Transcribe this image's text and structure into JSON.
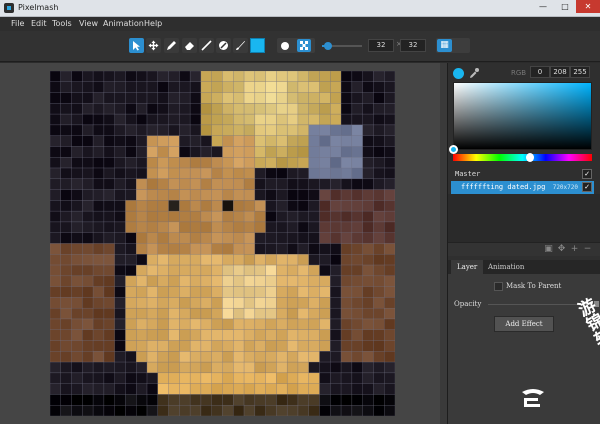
{
  "window": {
    "title": "Pixelmash"
  },
  "menu": [
    "File",
    "Edit",
    "Tools",
    "View",
    "Animation",
    "Help"
  ],
  "toolbar": {
    "tools": [
      "select-icon",
      "move-icon",
      "pencil-icon",
      "eraser-icon",
      "line-icon",
      "fill-icon",
      "brush-icon"
    ],
    "active_tool": "select-icon",
    "color": "#19b6f0",
    "brush_size": 0.15,
    "width": "32",
    "height": "32"
  },
  "color_panel": {
    "mode": "RGB",
    "r": "0",
    "g": "208",
    "b": "255"
  },
  "layers": {
    "master": "Master",
    "items": [
      {
        "name": "ffffffting dated.jpg",
        "size": "720x720"
      }
    ]
  },
  "tabs": [
    "Layer",
    "Animation"
  ],
  "layer_props": {
    "mask_label": "Mask To Parent",
    "opacity_label": "Opacity",
    "add_effect_label": "Add Effect"
  },
  "watermark": {
    "text": "游锦软件"
  }
}
